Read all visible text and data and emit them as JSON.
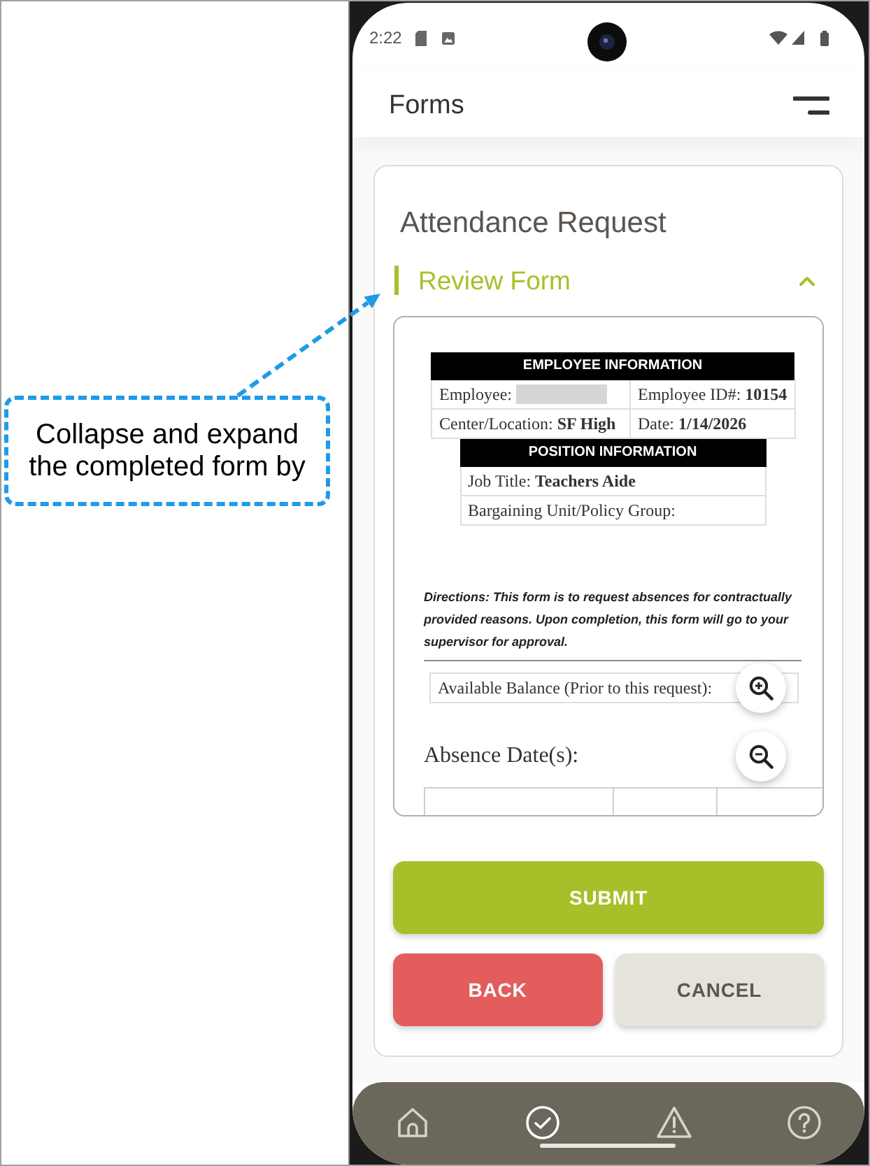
{
  "annotation": {
    "text": "Collapse and expand the completed form by"
  },
  "status_bar": {
    "time": "2:22"
  },
  "header": {
    "title": "Forms"
  },
  "form_card": {
    "title": "Attendance Request",
    "section": {
      "title": "Review Form",
      "expanded": true
    },
    "preview": {
      "tables": [
        {
          "heading": "EMPLOYEE INFORMATION",
          "rows": [
            [
              {
                "text": "Employee:",
                "redacted": true
              },
              {
                "text": "Employee ID#: **10154**",
                "redacted": false
              }
            ],
            [
              {
                "text": "Center/Location: **SF High**",
                "redacted": false
              },
              {
                "text": "Date: **1/14/2026**",
                "redacted": false
              }
            ]
          ]
        },
        {
          "heading": "POSITION INFORMATION",
          "rows": [
            [
              {
                "text": "Job Title: **Teachers Aide**",
                "redacted": false
              }
            ],
            [
              {
                "text": "Bargaining Unit/Policy Group:",
                "redacted": false
              }
            ]
          ]
        }
      ],
      "directions": "Directions: This form is to request absences for contractually provided reasons. Upon completion, this form will go to your supervisor for approval.",
      "balance_label": "Available Balance (Prior to this request):",
      "absence_dates_label": "Absence Date(s):"
    },
    "buttons": [
      {
        "label": "SUBMIT",
        "kind": "primary"
      },
      {
        "label": "BACK",
        "kind": "danger"
      },
      {
        "label": "CANCEL",
        "kind": "secondary"
      }
    ]
  },
  "bottom_nav": [
    {
      "selected": false
    },
    {
      "selected": true
    },
    {
      "selected": false
    },
    {
      "selected": false
    }
  ]
}
